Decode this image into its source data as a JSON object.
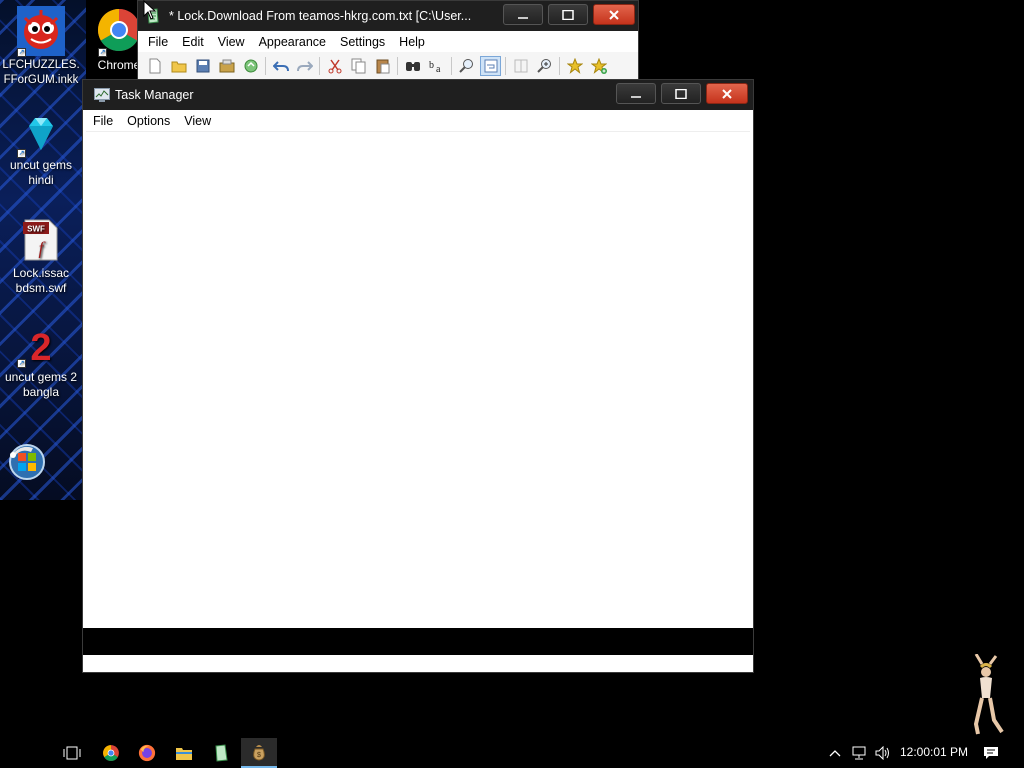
{
  "desktop": {
    "icons": [
      {
        "label": "LFCHUZZLES.\nFForGUM.inkk",
        "icon": "red-creature-icon"
      },
      {
        "label": "Chrome",
        "icon": "chrome-icon"
      },
      {
        "label": "uncut gems\nhindi",
        "icon": "gem-icon"
      },
      {
        "label": "Lock.issac\nbdsm.swf",
        "icon": "swf-file-icon"
      },
      {
        "label": "uncut gems 2\nbangla",
        "icon": "number-two-icon"
      },
      {
        "label": "",
        "icon": "windows-orb-icon"
      }
    ],
    "swf_badge": "SWF"
  },
  "notepad": {
    "title": "* Lock.Download From teamos-hkrg.com.txt [C:\\User...",
    "menu": [
      "File",
      "Edit",
      "View",
      "Appearance",
      "Settings",
      "Help"
    ],
    "toolbar": [
      "new-icon",
      "open-icon",
      "save-icon",
      "save-as-icon",
      "refresh-icon",
      "undo-icon",
      "redo-icon",
      "cut-icon",
      "copy-icon",
      "paste-icon",
      "find-icon",
      "replace-icon",
      "zoom-icon",
      "word-wrap-icon",
      "split-icon",
      "zoom-in-icon",
      "favorites-icon",
      "add-favorite-icon"
    ]
  },
  "taskmgr": {
    "title": "Task Manager",
    "menu": [
      "File",
      "Options",
      "View"
    ]
  },
  "taskbar": {
    "clock": "12:00:01 PM",
    "apps": [
      "task-view-icon",
      "chrome-icon",
      "firefox-icon",
      "file-explorer-icon",
      "notepad2-icon",
      "money-bag-icon"
    ]
  },
  "colors": {
    "titlebar": "#1f1f1f",
    "close_button": "#c5331c",
    "taskbar": "#000000",
    "active_app_underline": "#76b9ed"
  }
}
